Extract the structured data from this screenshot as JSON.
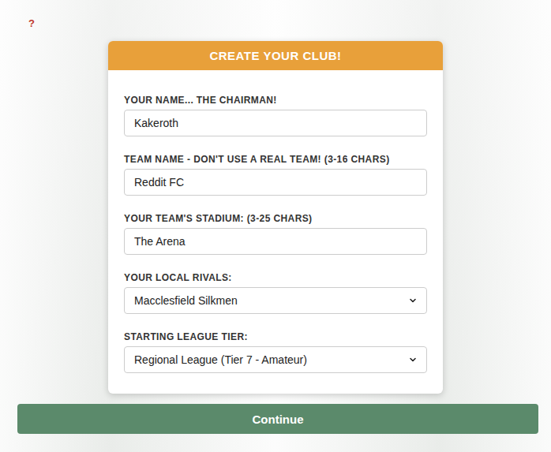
{
  "help": "?",
  "card": {
    "title": "CREATE YOUR CLUB!"
  },
  "fields": [
    {
      "label": "YOUR NAME... THE CHAIRMAN!",
      "value": "Kakeroth",
      "kind": "input"
    },
    {
      "label": "TEAM NAME - DON'T USE A REAL TEAM! (3-16 CHARS)",
      "value": "Reddit FC",
      "kind": "input"
    },
    {
      "label": "YOUR TEAM'S STADIUM: (3-25 CHARS)",
      "value": "The Arena",
      "kind": "input"
    },
    {
      "label": "YOUR LOCAL RIVALS:",
      "value": "Macclesfield Silkmen",
      "kind": "select"
    },
    {
      "label": "STARTING LEAGUE TIER:",
      "value": "Regional League (Tier 7 - Amateur)",
      "kind": "select"
    }
  ],
  "button": "Continue"
}
